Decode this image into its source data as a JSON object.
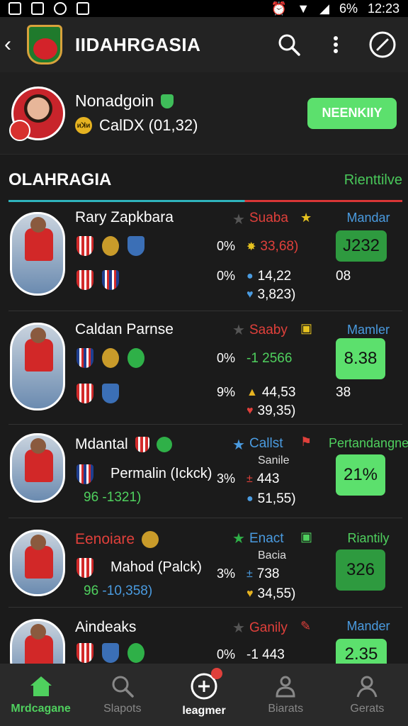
{
  "status": {
    "battery": "6%",
    "time": "12:23"
  },
  "app_bar": {
    "title": "IIDAHRGASIA"
  },
  "profile": {
    "name": "Nonadgoin",
    "coin_label": "ᴎꓘᴎ",
    "stat": "CalDX (01,32)",
    "button": "NEENKIIY"
  },
  "section": {
    "title": "OLAHRAGIA",
    "link": "Rienttilve"
  },
  "rows": [
    {
      "name": "Rary Zapkbara",
      "pct1": "0%",
      "pct2": "0%",
      "label": "Suaba",
      "val1": "33,68)",
      "val2": "14,22",
      "val3": "3,823)",
      "col_head": "Mandar",
      "score": "J232",
      "side": "08"
    },
    {
      "name": "Caldan Parnse",
      "pct1": "0%",
      "pct2": "9%",
      "label": "Saaby",
      "val1": "-1 2566",
      "val2": "44,53",
      "val3": "39,35)",
      "col_head": "Mamler",
      "score": "8.38",
      "side": "38"
    },
    {
      "name": "Mdantal",
      "meta": "Permalin (Ickck)",
      "meta_prefix": "96",
      "meta_value": "-1321)",
      "pct1": "3%",
      "label": "Callst",
      "sub_label": "Sanile",
      "val1": "443",
      "val2": "51,55)",
      "col_head": "Pertandangne",
      "score": "21%"
    },
    {
      "name": "Eenoiare",
      "meta": "Mahod (Palck)",
      "meta_prefix": "96",
      "meta_value": "-10,358)",
      "pct1": "3%",
      "label": "Enact",
      "sub_label": "Bacia",
      "val1": "738",
      "val2": "34,55)",
      "col_head": "Riantily",
      "score": "326"
    },
    {
      "name": "Aindeaks",
      "pct1": "0%",
      "label": "Ganily",
      "val1": "-1 443",
      "col_head": "Mander",
      "score": "2.35"
    }
  ],
  "nav": [
    {
      "label": "Mrdcagane"
    },
    {
      "label": "Slapots"
    },
    {
      "label": "leagmer"
    },
    {
      "label": "Biarats"
    },
    {
      "label": "Gerats"
    }
  ],
  "colors": {
    "accent_green": "#5ce06d",
    "accent_red": "#e0403b",
    "accent_blue": "#4a9be0",
    "background": "#1b1b1b"
  }
}
